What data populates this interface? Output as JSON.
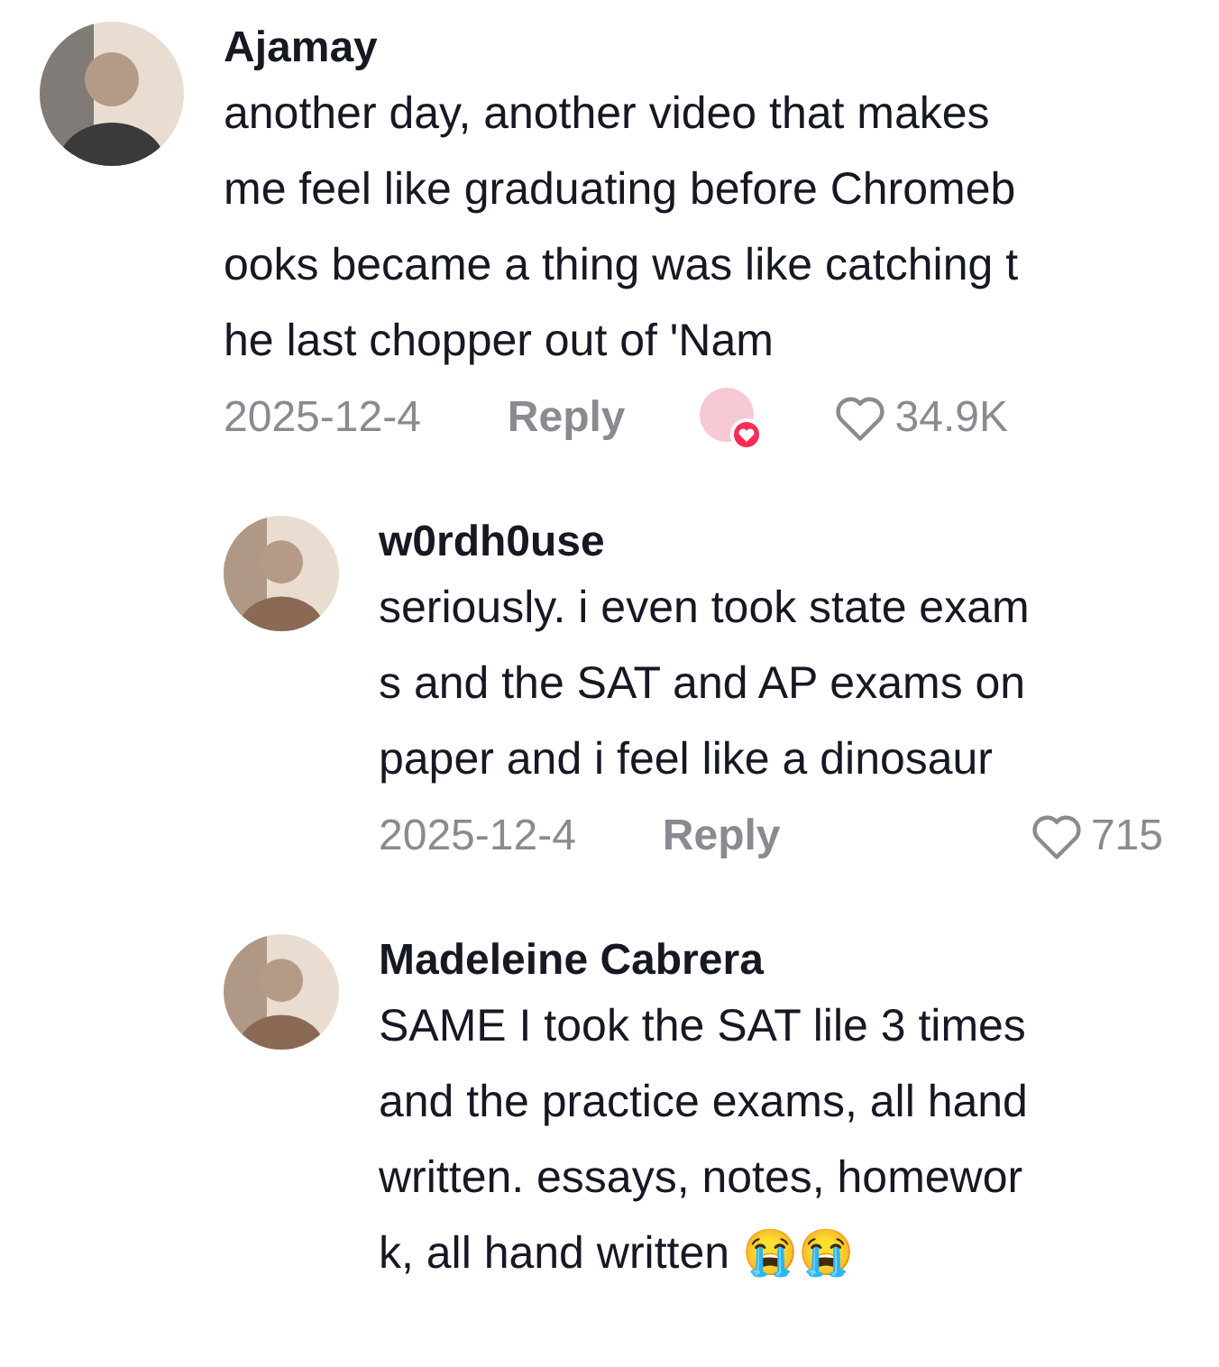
{
  "comments": [
    {
      "author": "Ajamay",
      "lines": [
        "another day, another video that makes",
        "me feel like graduating before Chromeb",
        "ooks became a thing was like catching t",
        "he last chopper out of 'Nam"
      ],
      "date": "2025-12-4",
      "reply_label": "Reply",
      "liked_by_creator": true,
      "likes": "34.9K",
      "replies": [
        {
          "author": "w0rdh0use",
          "lines": [
            "seriously. i even took state exam",
            "s and the SAT and AP exams on",
            "paper and i feel like a dinosaur"
          ],
          "date": "2025-12-4",
          "reply_label": "Reply",
          "liked_by_creator": false,
          "likes": "715"
        },
        {
          "author": "Madeleine Cabrera",
          "lines": [
            "SAME I took the SAT lile 3 times",
            "and the practice exams, all hand",
            "written. essays, notes, homewor",
            "k, all hand written 😭😭"
          ]
        }
      ]
    }
  ]
}
